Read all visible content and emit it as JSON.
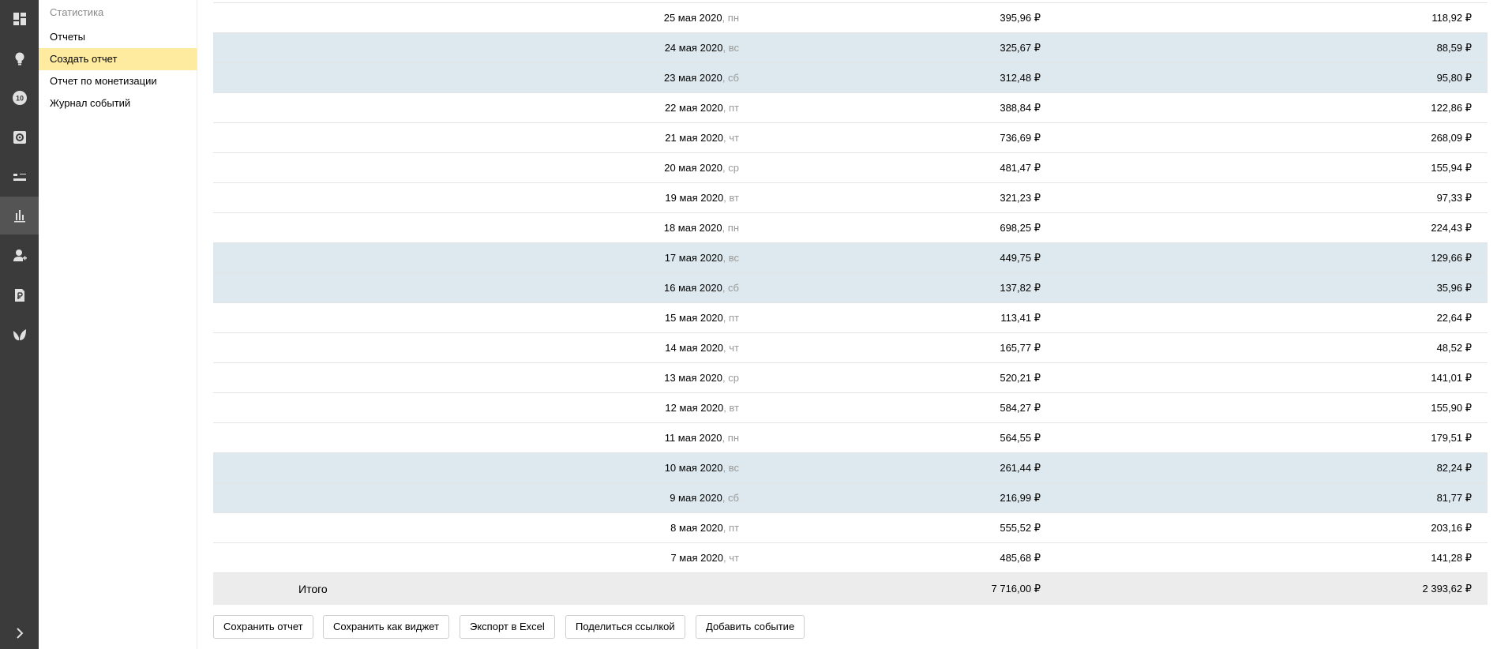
{
  "sidebar": {
    "heading": "Статистика",
    "items": [
      {
        "label": "Отчеты",
        "selected": false
      },
      {
        "label": "Создать отчет",
        "selected": true
      },
      {
        "label": "Отчет по монетизации",
        "selected": false
      },
      {
        "label": "Журнал событий",
        "selected": false
      }
    ]
  },
  "rail_icons": [
    "dashboard-icon",
    "lightbulb-icon",
    "number-10-badge-icon",
    "gear-icon",
    "sliders-icon",
    "bar-chart-icon",
    "user-add-icon",
    "ruble-document-icon",
    "leaf-icon",
    "chevron-right-icon"
  ],
  "rail": {
    "badge_number": "10"
  },
  "colors": {
    "rail_bg": "#3b3b3b",
    "selected_item": "#ffeba0",
    "weekend_row": "#dde9ee",
    "total_row": "#ececec"
  },
  "table": {
    "rows": [
      {
        "date": "25 мая 2020",
        "weekday": "пн",
        "revenue": "395,96 ₽",
        "income": "118,92 ₽",
        "weekend": false
      },
      {
        "date": "24 мая 2020",
        "weekday": "вс",
        "revenue": "325,67 ₽",
        "income": "88,59 ₽",
        "weekend": true
      },
      {
        "date": "23 мая 2020",
        "weekday": "сб",
        "revenue": "312,48 ₽",
        "income": "95,80 ₽",
        "weekend": true
      },
      {
        "date": "22 мая 2020",
        "weekday": "пт",
        "revenue": "388,84 ₽",
        "income": "122,86 ₽",
        "weekend": false
      },
      {
        "date": "21 мая 2020",
        "weekday": "чт",
        "revenue": "736,69 ₽",
        "income": "268,09 ₽",
        "weekend": false
      },
      {
        "date": "20 мая 2020",
        "weekday": "ср",
        "revenue": "481,47 ₽",
        "income": "155,94 ₽",
        "weekend": false
      },
      {
        "date": "19 мая 2020",
        "weekday": "вт",
        "revenue": "321,23 ₽",
        "income": "97,33 ₽",
        "weekend": false
      },
      {
        "date": "18 мая 2020",
        "weekday": "пн",
        "revenue": "698,25 ₽",
        "income": "224,43 ₽",
        "weekend": false
      },
      {
        "date": "17 мая 2020",
        "weekday": "вс",
        "revenue": "449,75 ₽",
        "income": "129,66 ₽",
        "weekend": true
      },
      {
        "date": "16 мая 2020",
        "weekday": "сб",
        "revenue": "137,82 ₽",
        "income": "35,96 ₽",
        "weekend": true
      },
      {
        "date": "15 мая 2020",
        "weekday": "пт",
        "revenue": "113,41 ₽",
        "income": "22,64 ₽",
        "weekend": false
      },
      {
        "date": "14 мая 2020",
        "weekday": "чт",
        "revenue": "165,77 ₽",
        "income": "48,52 ₽",
        "weekend": false
      },
      {
        "date": "13 мая 2020",
        "weekday": "ср",
        "revenue": "520,21 ₽",
        "income": "141,01 ₽",
        "weekend": false
      },
      {
        "date": "12 мая 2020",
        "weekday": "вт",
        "revenue": "584,27 ₽",
        "income": "155,90 ₽",
        "weekend": false
      },
      {
        "date": "11 мая 2020",
        "weekday": "пн",
        "revenue": "564,55 ₽",
        "income": "179,51 ₽",
        "weekend": false
      },
      {
        "date": "10 мая 2020",
        "weekday": "вс",
        "revenue": "261,44 ₽",
        "income": "82,24 ₽",
        "weekend": true
      },
      {
        "date": "9 мая 2020",
        "weekday": "сб",
        "revenue": "216,99 ₽",
        "income": "81,77 ₽",
        "weekend": true
      },
      {
        "date": "8 мая 2020",
        "weekday": "пт",
        "revenue": "555,52 ₽",
        "income": "203,16 ₽",
        "weekend": false
      },
      {
        "date": "7 мая 2020",
        "weekday": "чт",
        "revenue": "485,68 ₽",
        "income": "141,28 ₽",
        "weekend": false
      }
    ],
    "total": {
      "label": "Итого",
      "revenue": "7 716,00 ₽",
      "income": "2 393,62 ₽"
    }
  },
  "buttons": [
    {
      "name": "save-report-button",
      "label": "Сохранить отчет"
    },
    {
      "name": "save-as-widget-button",
      "label": "Сохранить как виджет"
    },
    {
      "name": "export-excel-button",
      "label": "Экспорт в Excel"
    },
    {
      "name": "share-link-button",
      "label": "Поделиться ссылкой"
    },
    {
      "name": "add-event-button",
      "label": "Добавить событие"
    }
  ]
}
